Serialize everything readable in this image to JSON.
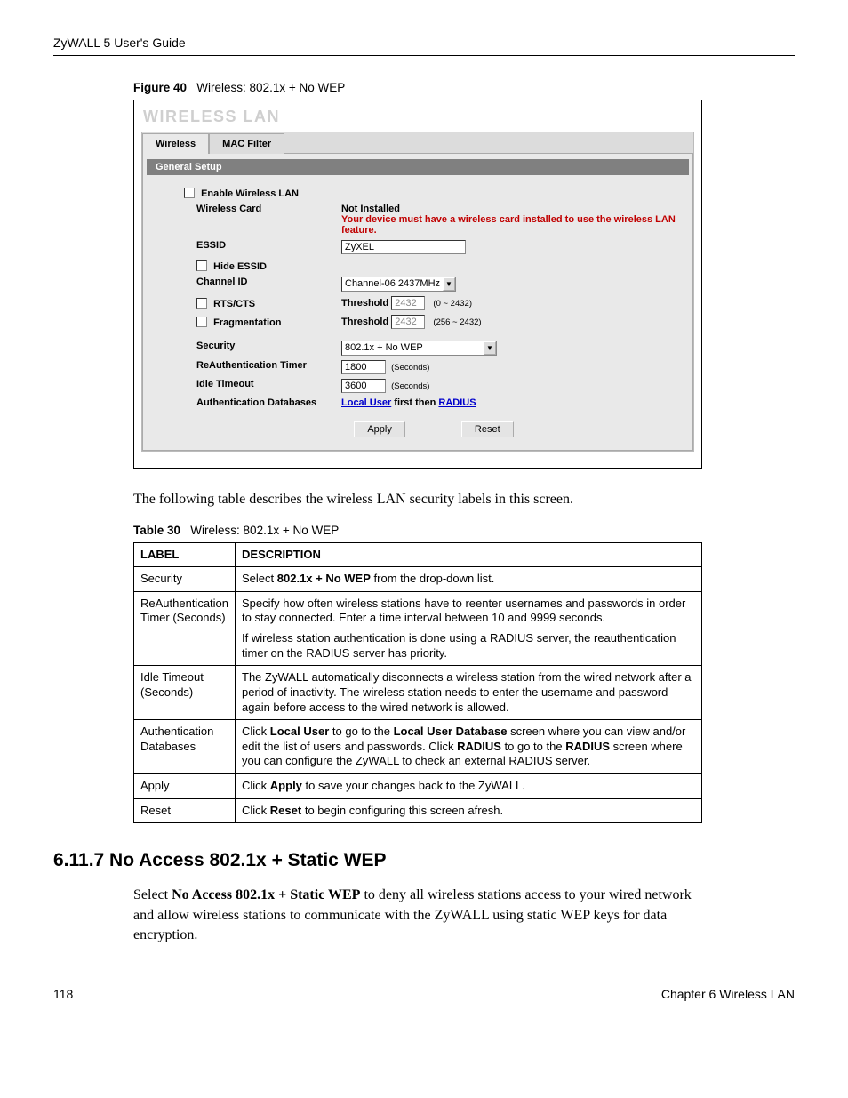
{
  "header": {
    "guide_title": "ZyWALL 5 User's Guide"
  },
  "figure": {
    "label": "Figure 40",
    "title": "Wireless: 802.1x + No WEP"
  },
  "panel": {
    "heading": "WIRELESS LAN",
    "tabs": {
      "wireless": "Wireless",
      "mac_filter": "MAC Filter"
    },
    "section_bar": "General Setup",
    "labels": {
      "enable_wlan": "Enable Wireless LAN",
      "wireless_card": "Wireless Card",
      "essid": "ESSID",
      "hide_essid": "Hide ESSID",
      "channel_id": "Channel ID",
      "rts_cts": "RTS/CTS",
      "fragmentation": "Fragmentation",
      "security": "Security",
      "reauth_timer": "ReAuthentication Timer",
      "idle_timeout": "Idle Timeout",
      "auth_db": "Authentication Databases",
      "threshold": "Threshold",
      "seconds_note": "(Seconds)",
      "rts_range": "(0 ~ 2432)",
      "frag_range": "(256 ~ 2432)"
    },
    "values": {
      "not_installed": "Not Installed",
      "card_warning": "Your device must have a wireless card installed to use the wireless LAN feature.",
      "essid": "ZyXEL",
      "channel": "Channel-06 2437MHz",
      "rts_threshold": "2432",
      "frag_threshold": "2432",
      "security": "802.1x + No WEP",
      "reauth_timer": "1800",
      "idle_timeout": "3600",
      "auth_db_prefix": "Local User",
      "auth_db_mid": " first then ",
      "auth_db_suffix": "RADIUS"
    },
    "buttons": {
      "apply": "Apply",
      "reset": "Reset"
    }
  },
  "intro_text": "The following table describes the wireless LAN security labels in this screen.",
  "table": {
    "caption_label": "Table 30",
    "caption_title": "Wireless: 802.1x + No WEP",
    "head": {
      "label": "LABEL",
      "desc": "DESCRIPTION"
    },
    "rows": {
      "r0": {
        "label": "Security",
        "d1": "Select ",
        "d1b": "802.1x + No WEP",
        "d2": " from the drop-down list."
      },
      "r1": {
        "label": "ReAuthentication Timer (Seconds)",
        "p1": "Specify how often wireless stations have to reenter usernames and passwords in order to stay connected. Enter a time interval between 10 and 9999 seconds.",
        "p2": "If wireless station authentication is done using a RADIUS server, the reauthentication timer on the RADIUS server has priority."
      },
      "r2": {
        "label": "Idle Timeout (Seconds)",
        "d": "The ZyWALL automatically disconnects a wireless station from the wired network after a period of inactivity. The wireless station needs to enter the username and password again before access to the wired network is allowed."
      },
      "r3": {
        "label": "Authentication Databases",
        "t1": "Click ",
        "b1": "Local User",
        "t2": " to go to the ",
        "b2": "Local User Database",
        "t3": " screen where you can view and/or edit the list of users and passwords. Click ",
        "b3": "RADIUS",
        "t4": " to go to the ",
        "b4": "RADIUS",
        "t5": " screen where you can configure the ZyWALL to check an external RADIUS server."
      },
      "r4": {
        "label": "Apply",
        "t1": "Click ",
        "b1": "Apply",
        "t2": " to save your changes back to the ZyWALL."
      },
      "r5": {
        "label": "Reset",
        "t1": "Click ",
        "b1": "Reset",
        "t2": " to begin configuring this screen afresh."
      }
    }
  },
  "section": {
    "heading": "6.11.7  No Access 802.1x + Static WEP",
    "t1": "Select ",
    "b1": "No Access 802.1x + Static WEP",
    "t2": " to deny all wireless stations access to your wired network and allow wireless stations to communicate with the ZyWALL using static WEP keys for data encryption."
  },
  "footer": {
    "page": "118",
    "chapter": "Chapter 6 Wireless LAN"
  }
}
